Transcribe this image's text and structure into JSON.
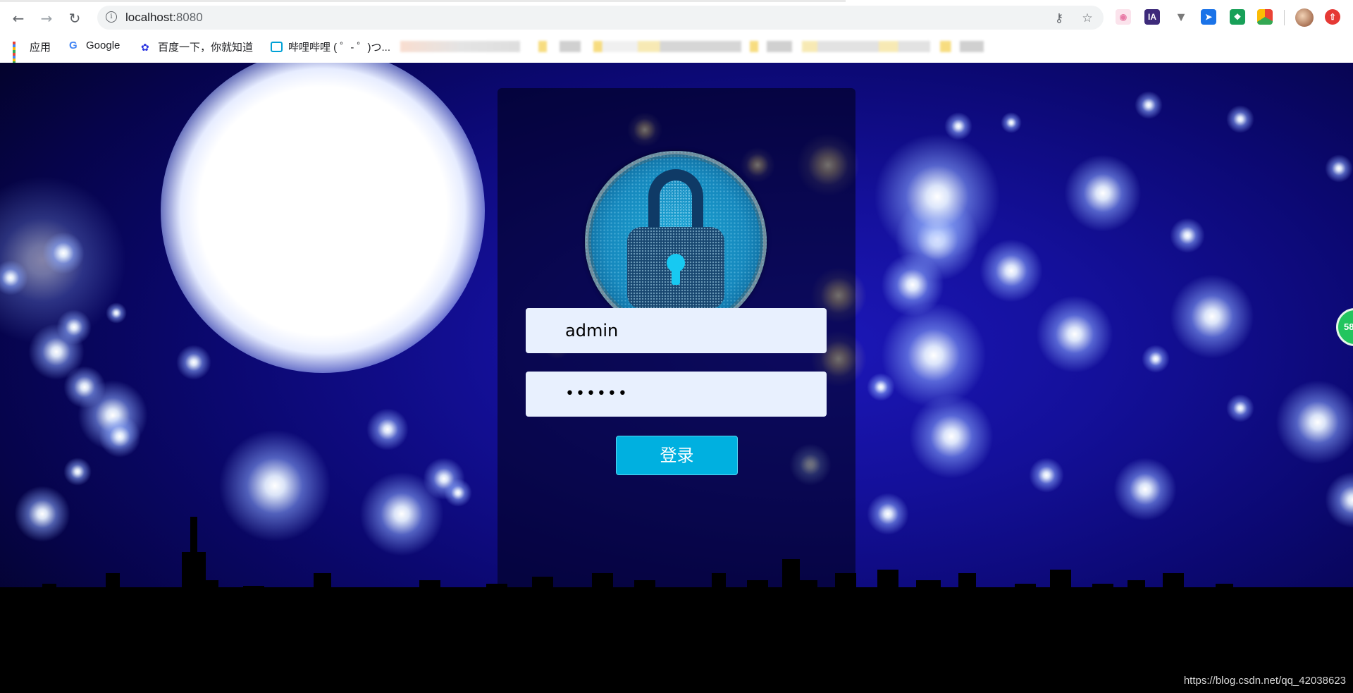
{
  "browser": {
    "url_host": "localhost:",
    "url_port": "8080",
    "bookmarks": [
      {
        "label": "应用"
      },
      {
        "label": "Google"
      },
      {
        "label": "百度一下，你就知道"
      },
      {
        "label": "哔哩哔哩 ( ゜- ゜)つ..."
      }
    ],
    "ext_ia": "IA"
  },
  "login": {
    "username": "admin",
    "password_mask": "••••••",
    "submit_label": "登录"
  },
  "floating_badge": "58",
  "watermark": "https://blog.csdn.net/qq_42038623",
  "colors": {
    "button": "#00b0e0",
    "field_bg": "#e8f0fe",
    "sky": "#14109a"
  }
}
